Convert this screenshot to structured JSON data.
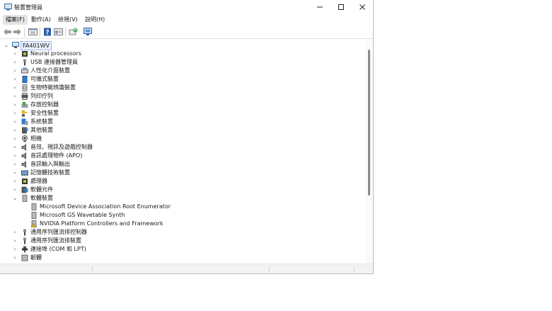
{
  "window": {
    "title": "裝置管理員",
    "controls": {
      "minimize": "minimize-icon",
      "maximize": "maximize-icon",
      "close": "close-icon"
    }
  },
  "menubar": [
    {
      "label": "檔案(F)",
      "active": true
    },
    {
      "label": "動作(A)"
    },
    {
      "label": "檢視(V)"
    },
    {
      "label": "說明(H)"
    }
  ],
  "toolbar": [
    "back-arrow-icon",
    "forward-arrow-icon",
    "properties-icon",
    "help-icon",
    "view-icon",
    "update-driver-icon",
    "scan-hardware-icon"
  ],
  "tree": {
    "root": "FA401WV",
    "items": [
      {
        "label": "Neural processors",
        "icon": "chip-icon"
      },
      {
        "label": "USB 連接器管理員",
        "icon": "usb-icon"
      },
      {
        "label": "人性化介面裝置",
        "icon": "hid-icon"
      },
      {
        "label": "可攜式裝置",
        "icon": "portable-device-icon"
      },
      {
        "label": "生物特徵辨識裝置",
        "icon": "biometric-icon"
      },
      {
        "label": "列印佇列",
        "icon": "printer-icon"
      },
      {
        "label": "存放控制器",
        "icon": "storage-controller-icon"
      },
      {
        "label": "安全性裝置",
        "icon": "security-key-icon"
      },
      {
        "label": "系統裝置",
        "icon": "system-device-icon"
      },
      {
        "label": "其他裝置",
        "icon": "other-device-icon"
      },
      {
        "label": "相機",
        "icon": "camera-icon"
      },
      {
        "label": "音效、視訊及遊戲控制器",
        "icon": "speaker-icon"
      },
      {
        "label": "音訊處理物件 (APO)",
        "icon": "speaker-icon"
      },
      {
        "label": "音訊輸入與輸出",
        "icon": "speaker-icon"
      },
      {
        "label": "記憶體技術裝置",
        "icon": "memory-icon"
      },
      {
        "label": "處理器",
        "icon": "processor-icon"
      },
      {
        "label": "軟體元件",
        "icon": "software-component-icon"
      },
      {
        "label": "軟體裝置",
        "icon": "software-device-icon",
        "expanded": true,
        "children": [
          {
            "label": "Microsoft Device Association Root Enumerator",
            "icon": "device-icon"
          },
          {
            "label": "Microsoft GS Wavetable Synth",
            "icon": "device-icon"
          },
          {
            "label": "NVIDIA Platform Controllers and Framework",
            "icon": "warning-device-icon"
          }
        ]
      },
      {
        "label": "通用序列匯流排控制器",
        "icon": "usb-icon"
      },
      {
        "label": "通用序列匯流排裝置",
        "icon": "usb-icon"
      },
      {
        "label": "連接埠 (COM 和 LPT)",
        "icon": "port-icon"
      },
      {
        "label": "韌體",
        "icon": "firmware-icon"
      }
    ]
  }
}
